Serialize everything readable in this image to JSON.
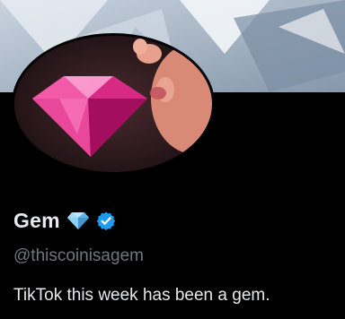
{
  "profile": {
    "display_name": "Gem",
    "handle": "@thiscoinisagem",
    "bio": "TikTok this week has been a gem.",
    "name_emoji": "gem-stone-emoji",
    "verified_badge": "verified-badge-icon",
    "avatar_image": "pink-diamond-kiss-avatar",
    "banner_image": "silver-diamond-banner"
  },
  "colors": {
    "background": "#000000",
    "text_primary": "#e7e9ea",
    "text_secondary": "#71767b",
    "verified_blue": "#1d9bf0",
    "gem_blue": "#7cc6f2",
    "avatar_gem_pink": "#e0298a"
  }
}
